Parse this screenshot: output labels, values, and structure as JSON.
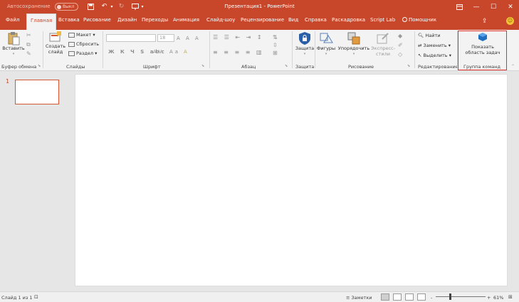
{
  "titlebar": {
    "autosave": "Автосохранение",
    "toggle": "Выкл",
    "title": "Презентация1 - PowerPoint"
  },
  "tabs": [
    "Файл",
    "Главная",
    "Вставка",
    "Рисование",
    "Дизайн",
    "Переходы",
    "Анимация",
    "Слайд-шоу",
    "Рецензирование",
    "Вид",
    "Справка",
    "Раскадровка",
    "Script Lab",
    "Помощник"
  ],
  "ribbon": {
    "clipboard": {
      "paste": "Вставить",
      "group": "Буфер обмена"
    },
    "slides": {
      "new_slide_1": "Создать",
      "new_slide_2": "слайд",
      "layout": "Макет",
      "reset": "Сбросить",
      "section": "Раздел",
      "group": "Слайды"
    },
    "font": {
      "size": "18",
      "group": "Шрифт"
    },
    "paragraph": {
      "group": "Абзац"
    },
    "protect": {
      "label": "Защита",
      "group": "Защита"
    },
    "drawing": {
      "shapes": "Фигуры",
      "arrange": "Упорядочить",
      "styles_1": "Экспресс-",
      "styles_2": "стили",
      "group": "Рисование"
    },
    "editing": {
      "find": "Найти",
      "replace": "Заменить",
      "select": "Выделить",
      "group": "Редактирование"
    },
    "commands": {
      "show_1": "Показать",
      "show_2": "область задач",
      "group": "Группа команд"
    }
  },
  "slides_panel": {
    "number": "1"
  },
  "status": {
    "slide": "Слайд 1 из 1",
    "notes": "Заметки",
    "zoom": "61%",
    "minus": "-",
    "plus": "+"
  }
}
